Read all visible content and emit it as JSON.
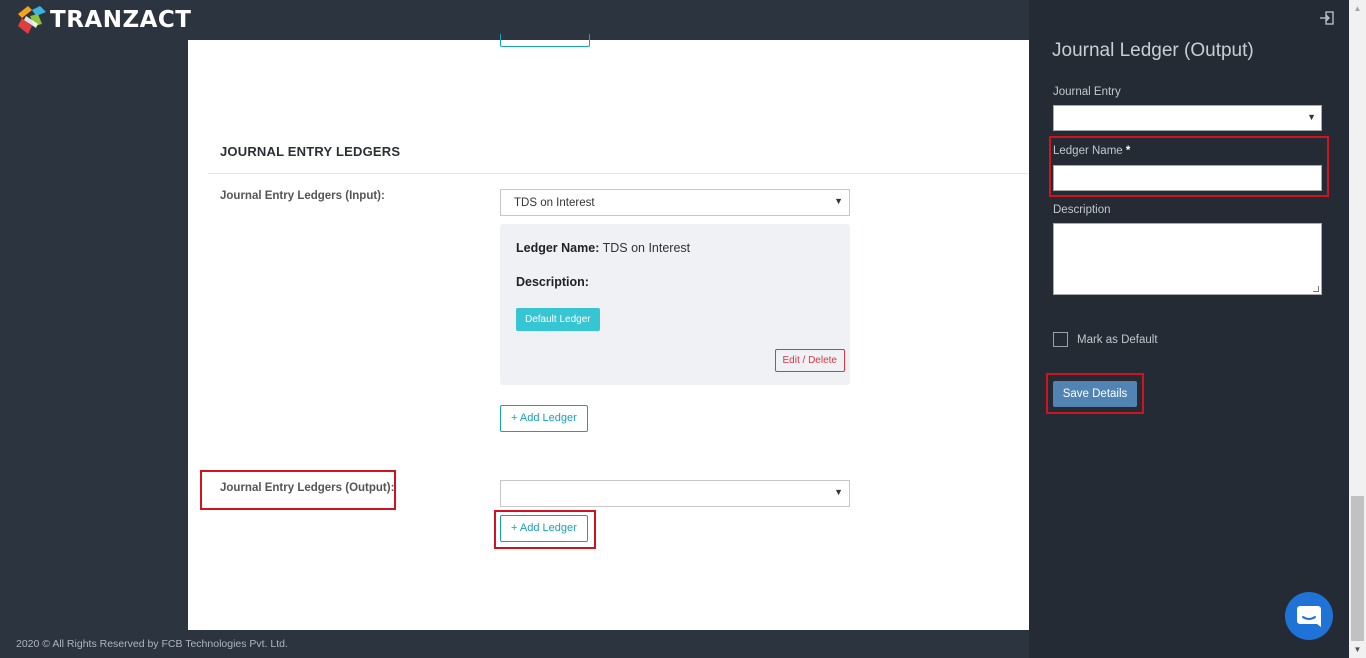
{
  "brand": {
    "name": "TRANZACT"
  },
  "section": {
    "title": "JOURNAL ENTRY LEDGERS"
  },
  "input_ledgers": {
    "label": "Journal Entry Ledgers (Input):",
    "selected": "TDS on Interest",
    "card": {
      "name_label": "Ledger Name:",
      "name_value": "TDS on Interest",
      "description_label": "Description:",
      "default_badge": "Default Ledger",
      "edit_delete": "Edit / Delete"
    },
    "add_button": "+ Add Ledger"
  },
  "output_ledgers": {
    "label": "Journal Entry Ledgers (Output):",
    "selected": "",
    "add_button": "+ Add Ledger"
  },
  "footer": {
    "text": "2020 © All Rights Reserved by FCB Technologies Pvt. Ltd."
  },
  "panel": {
    "title": "Journal Ledger (Output)",
    "journal_entry_label": "Journal Entry",
    "journal_entry_value": "",
    "ledger_name_label": "Ledger Name",
    "ledger_name_required": "*",
    "ledger_name_value": "",
    "description_label": "Description",
    "description_value": "",
    "mark_default_label": "Mark as Default",
    "mark_default_checked": false,
    "save_button": "Save Details"
  },
  "colors": {
    "sidebar_bg": "#2c3440",
    "panel_bg": "#252b35",
    "accent_teal": "#17a2b8",
    "badge_cyan": "#35c5d3",
    "danger": "#dc3545",
    "save_blue": "#5184b3",
    "highlight_red": "#d0141f",
    "chat_blue": "#1f73d6"
  },
  "icons": {
    "panel_exit": "sign-out-icon",
    "chat": "chat-bubble-icon",
    "select_caret": "caret-down-icon"
  }
}
